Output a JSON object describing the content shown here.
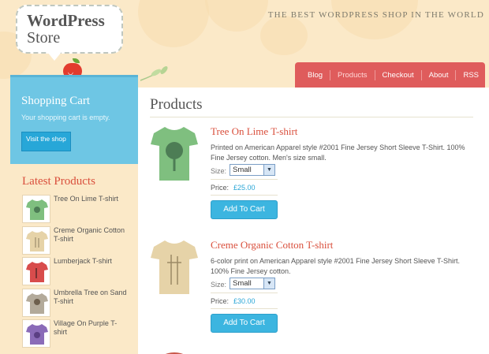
{
  "logo": {
    "line1": "WordPress",
    "line2": "Store"
  },
  "tagline": "THE BEST WORDPRESS SHOP IN THE WORLD",
  "nav": {
    "items": [
      "Blog",
      "Products",
      "Checkout",
      "About",
      "RSS"
    ],
    "active": "Products"
  },
  "cart": {
    "title": "Shopping Cart",
    "text": "Your shopping cart is empty.",
    "button": "Visit the shop"
  },
  "latest": {
    "title": "Latest Products",
    "items": [
      {
        "name": "Tree On Lime T-shirt"
      },
      {
        "name": "Creme Organic Cotton T-shirt"
      },
      {
        "name": "Lumberjack T-shirt"
      },
      {
        "name": "Umbrella Tree on Sand T-shirt"
      },
      {
        "name": "Village On Purple T-shirt"
      }
    ]
  },
  "main": {
    "title": "Products",
    "products": [
      {
        "name": "Tree On Lime T-shirt",
        "description": "Printed on American Apparel style #2001 Fine Jersey Short Sleeve T-Shirt. 100% Fine Jersey cotton. Men's size small.",
        "size_label": "Size:",
        "size_value": "Small",
        "price_label": "Price:",
        "price": "£25.00",
        "button": "Add To Cart"
      },
      {
        "name": "Creme Organic Cotton T-shirt",
        "description": "6-color print on American Apparel style #2001 Fine Jersey Short Sleeve T-Shirt. 100% Fine Jersey cotton.",
        "size_label": "Size:",
        "size_value": "Small",
        "price_label": "Price:",
        "price": "£30.00",
        "button": "Add To Cart"
      }
    ]
  },
  "colors": {
    "background": "#fbe9c8",
    "nav": "#df5c5c",
    "cart": "#6ec6e4",
    "heading_red": "#d94f3c",
    "button_blue": "#3cb5e0",
    "shirt_colors": [
      "#7fbf7f",
      "#e6d3a8",
      "#d84c4c",
      "#b3aa9a",
      "#8a6bb8"
    ]
  }
}
